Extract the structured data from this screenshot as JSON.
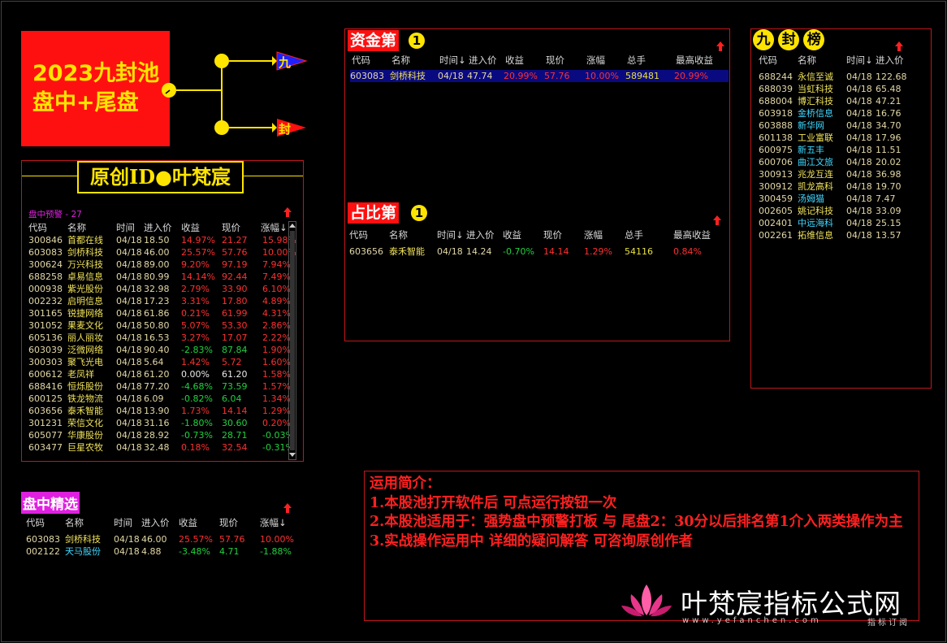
{
  "logo": {
    "line1": "2023九封池",
    "line2": "盘中+尾盘",
    "branch1": "九",
    "branch2": "封"
  },
  "author_banner": {
    "text": "原创ID●叶梵宸"
  },
  "pool": {
    "title": "盘中预警 - 27",
    "headers": [
      "代码",
      "名称",
      "时间",
      "进入价",
      "收益",
      "现价",
      "涨幅↓"
    ],
    "rows": [
      {
        "code": "300846",
        "name": "首都在线",
        "date": "04/18",
        "entry": "18.50",
        "gain": "14.97%",
        "price": "21.27",
        "pct": "15.98%",
        "dir": "up"
      },
      {
        "code": "603083",
        "name": "剑桥科技",
        "date": "04/18",
        "entry": "46.00",
        "gain": "25.57%",
        "price": "57.76",
        "pct": "10.00%",
        "dir": "up"
      },
      {
        "code": "300624",
        "name": "万兴科技",
        "date": "04/18",
        "entry": "89.00",
        "gain": "9.20%",
        "price": "97.19",
        "pct": "7.94%",
        "dir": "up"
      },
      {
        "code": "688258",
        "name": "卓易信息",
        "date": "04/18",
        "entry": "80.99",
        "gain": "14.14%",
        "price": "92.44",
        "pct": "7.49%",
        "dir": "up"
      },
      {
        "code": "000938",
        "name": "紫光股份",
        "date": "04/18",
        "entry": "32.98",
        "gain": "2.79%",
        "price": "33.90",
        "pct": "6.10%",
        "dir": "up"
      },
      {
        "code": "002232",
        "name": "启明信息",
        "date": "04/18",
        "entry": "17.23",
        "gain": "3.31%",
        "price": "17.80",
        "pct": "4.89%",
        "dir": "up"
      },
      {
        "code": "301165",
        "name": "锐捷网络",
        "date": "04/18",
        "entry": "61.86",
        "gain": "0.21%",
        "price": "61.99",
        "pct": "4.31%",
        "dir": "up"
      },
      {
        "code": "301052",
        "name": "果麦文化",
        "date": "04/18",
        "entry": "50.80",
        "gain": "5.07%",
        "price": "53.30",
        "pct": "2.86%",
        "dir": "up"
      },
      {
        "code": "605136",
        "name": "丽人丽妆",
        "date": "04/18",
        "entry": "16.53",
        "gain": "3.27%",
        "price": "17.07",
        "pct": "2.22%",
        "dir": "up"
      },
      {
        "code": "603039",
        "name": "泛微网络",
        "date": "04/18",
        "entry": "90.40",
        "gain": "-2.83%",
        "price": "87.84",
        "pct": "1.90%",
        "dir": "down"
      },
      {
        "code": "300303",
        "name": "聚飞光电",
        "date": "04/18",
        "entry": "5.64",
        "gain": "1.42%",
        "price": "5.72",
        "pct": "1.60%",
        "dir": "up"
      },
      {
        "code": "600612",
        "name": "老凤祥",
        "date": "04/18",
        "entry": "61.20",
        "gain": "0.00%",
        "price": "61.20",
        "pct": "1.58%",
        "dir": "flat"
      },
      {
        "code": "688416",
        "name": "恒烁股份",
        "date": "04/18",
        "entry": "77.20",
        "gain": "-4.68%",
        "price": "73.59",
        "pct": "1.57%",
        "dir": "down"
      },
      {
        "code": "600125",
        "name": "铁龙物流",
        "date": "04/18",
        "entry": "6.09",
        "gain": "-0.82%",
        "price": "6.04",
        "pct": "1.34%",
        "dir": "down"
      },
      {
        "code": "603656",
        "name": "泰禾智能",
        "date": "04/18",
        "entry": "13.90",
        "gain": "1.73%",
        "price": "14.14",
        "pct": "1.29%",
        "dir": "up"
      },
      {
        "code": "301231",
        "name": "荣信文化",
        "date": "04/18",
        "entry": "31.16",
        "gain": "-1.80%",
        "price": "30.60",
        "pct": "0.20%",
        "dir": "down"
      },
      {
        "code": "605077",
        "name": "华康股份",
        "date": "04/18",
        "entry": "28.92",
        "gain": "-0.73%",
        "price": "28.71",
        "pct": "-0.03%",
        "dir": "down"
      },
      {
        "code": "603477",
        "name": "巨星农牧",
        "date": "04/18",
        "entry": "32.48",
        "gain": "0.18%",
        "price": "32.54",
        "pct": "-0.31%",
        "dir": "up"
      }
    ]
  },
  "intraday": {
    "title": "盘中精选",
    "headers": [
      "代码",
      "名称",
      "时间",
      "进入价",
      "收益",
      "现价",
      "涨幅↓"
    ],
    "rows": [
      {
        "code": "603083",
        "name": "剑桥科技",
        "date": "04/18",
        "entry": "46.00",
        "gain": "25.57%",
        "price": "57.76",
        "pct": "10.00%",
        "dir": "up"
      },
      {
        "code": "002122",
        "name": "天马股份",
        "date": "04/18",
        "entry": "4.88",
        "gain": "-3.48%",
        "price": "4.71",
        "pct": "-1.88%",
        "dir": "down"
      }
    ]
  },
  "capital": {
    "title": "资金第",
    "rank": "1",
    "headers": [
      "代码",
      "名称",
      "时间↓",
      "进入价",
      "收益",
      "现价",
      "涨幅",
      "总手",
      "最高收益"
    ],
    "rows": [
      {
        "code": "603083",
        "name": "剑桥科技",
        "date": "04/18",
        "entry": "47.74",
        "gain": "20.99%",
        "price": "57.76",
        "pct": "10.00%",
        "vol": "589481",
        "max": "20.99%"
      }
    ]
  },
  "ratio": {
    "title": "占比第",
    "rank": "1",
    "headers": [
      "代码",
      "名称",
      "时间↓",
      "进入价",
      "收益",
      "现价",
      "涨幅",
      "总手",
      "最高收益"
    ],
    "rows": [
      {
        "code": "603656",
        "name": "泰禾智能",
        "date": "04/18",
        "entry": "14.24",
        "gain": "-0.70%",
        "price": "14.14",
        "pct": "1.29%",
        "vol": "54116",
        "max": "0.84%"
      }
    ]
  },
  "ranking": {
    "title": [
      "九",
      "封",
      "榜"
    ],
    "headers": [
      "代码",
      "名称",
      "时间↓",
      "进入价"
    ],
    "rows": [
      {
        "code": "688244",
        "name": "永信至诚",
        "date": "04/18",
        "entry": "122.68",
        "cyan": false
      },
      {
        "code": "688039",
        "name": "当虹科技",
        "date": "04/18",
        "entry": "65.48",
        "cyan": false
      },
      {
        "code": "688004",
        "name": "博汇科技",
        "date": "04/18",
        "entry": "47.21",
        "cyan": false
      },
      {
        "code": "603918",
        "name": "金桥信息",
        "date": "04/18",
        "entry": "16.76",
        "cyan": true
      },
      {
        "code": "603888",
        "name": "新华网",
        "date": "04/18",
        "entry": "34.70",
        "cyan": true
      },
      {
        "code": "601138",
        "name": "工业富联",
        "date": "04/18",
        "entry": "17.96",
        "cyan": false
      },
      {
        "code": "600975",
        "name": "新五丰",
        "date": "04/18",
        "entry": "11.51",
        "cyan": true
      },
      {
        "code": "600706",
        "name": "曲江文旅",
        "date": "04/18",
        "entry": "20.02",
        "cyan": true
      },
      {
        "code": "300913",
        "name": "兆龙互连",
        "date": "04/18",
        "entry": "36.98",
        "cyan": false
      },
      {
        "code": "300912",
        "name": "凯龙高科",
        "date": "04/18",
        "entry": "19.70",
        "cyan": false
      },
      {
        "code": "300459",
        "name": "汤姆猫",
        "date": "04/18",
        "entry": "7.47",
        "cyan": true
      },
      {
        "code": "002605",
        "name": "姚记科技",
        "date": "04/18",
        "entry": "33.09",
        "cyan": false
      },
      {
        "code": "002401",
        "name": "中远海科",
        "date": "04/18",
        "entry": "25.15",
        "cyan": true
      },
      {
        "code": "002261",
        "name": "拓维信息",
        "date": "04/18",
        "entry": "13.57",
        "cyan": false
      }
    ]
  },
  "usage": {
    "lines": [
      "运用简介：",
      "1.本股池打开软件后 可点运行按钮一次",
      "2.本股池适用于：强势盘中预警打板 与 尾盘2：30分以后排名第1介入两类操作为主",
      "3.实战操作运用中 详细的疑问解答 可咨询原创作者"
    ]
  },
  "watermark": {
    "title": "叶梵宸指标公式网",
    "url": "www.yefanchen.com",
    "sub": "指标订阅"
  },
  "colors": {
    "up": "#ff3030",
    "down": "#22d040",
    "panel_border": "#c0161b",
    "accent_yellow": "#ffe400"
  }
}
